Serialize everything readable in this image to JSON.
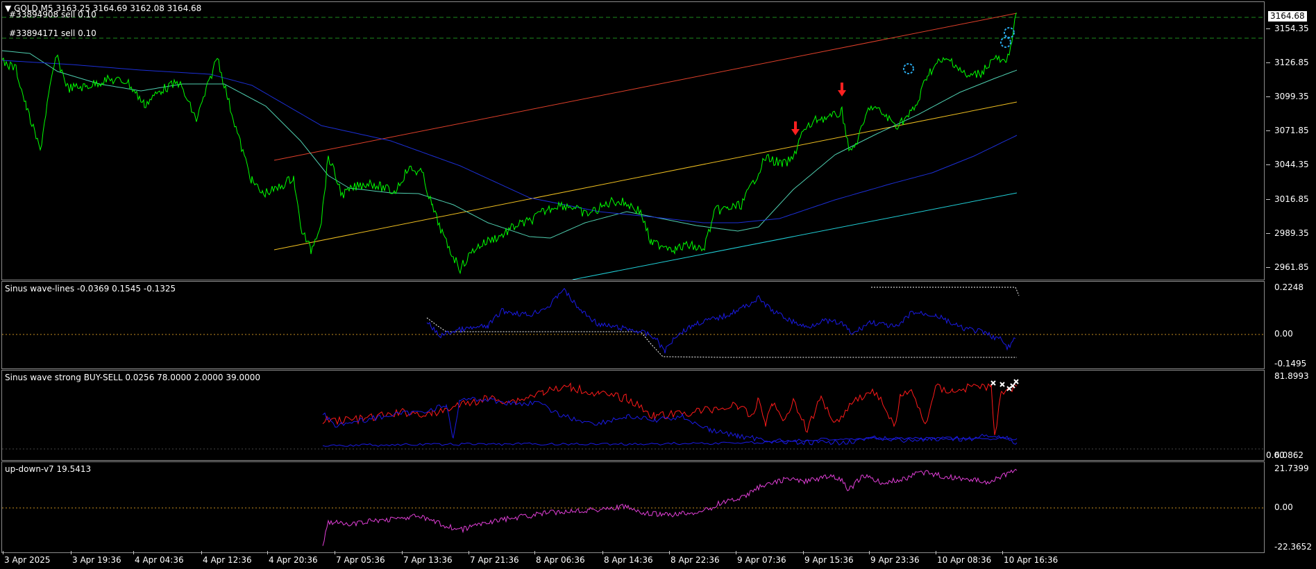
{
  "main_chart": {
    "header": "GOLD,M5  3163.25 3164.69 3162.08 3164.68",
    "orders": [
      "#33894908 sell 0.10",
      "#33894171 sell 0.10"
    ],
    "current_price": "3164.68",
    "price_labels": [
      "3154.35",
      "3126.85",
      "3099.35",
      "3071.85",
      "3044.35",
      "3016.85",
      "2989.35",
      "2961.85"
    ],
    "colors": {
      "price": "#00ff00",
      "ma_fast": "#4fcfb0",
      "ma_slow": "#1c2fd6",
      "channel_top": "#e0402a",
      "channel_mid": "#f0c020",
      "channel_bottom": "#20d0d8",
      "order_line": "#1e8c1e"
    }
  },
  "indicator1": {
    "title": "Sinus wave-lines -0.0369 0.1545 -0.1325",
    "labels": [
      "0.2248",
      "0.00",
      "-0.1495"
    ]
  },
  "indicator2": {
    "title": "Sinus wave strong BUY-SELL 0.0256 78.0000 2.0000 39.0000",
    "labels": [
      "81.8993",
      "6.0862",
      "0.00"
    ]
  },
  "indicator3": {
    "title": "up-down-v7 19.5413",
    "labels": [
      "21.7399",
      "0.00",
      "-22.3652"
    ]
  },
  "time_axis": [
    "3 Apr 2025",
    "3 Apr 19:36",
    "4 Apr 04:36",
    "4 Apr 12:36",
    "4 Apr 20:36",
    "7 Apr 05:36",
    "7 Apr 13:36",
    "7 Apr 21:36",
    "8 Apr 06:36",
    "8 Apr 14:36",
    "8 Apr 22:36",
    "9 Apr 07:36",
    "9 Apr 15:36",
    "9 Apr 23:36",
    "10 Apr 08:36",
    "10 Apr 16:36"
  ]
}
